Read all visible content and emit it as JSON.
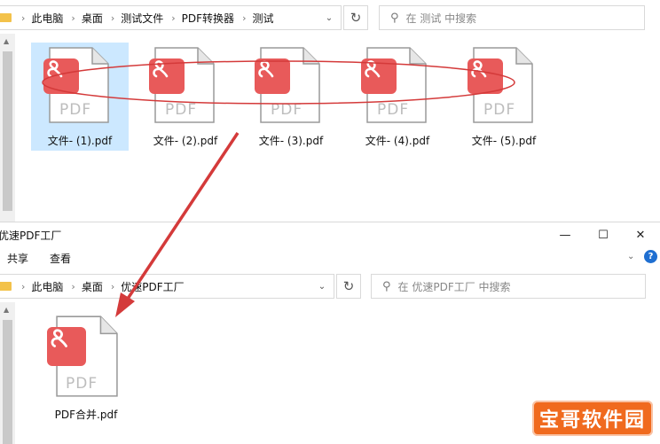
{
  "top_window": {
    "breadcrumb": [
      "此电脑",
      "桌面",
      "测试文件",
      "PDF转换器",
      "测试"
    ],
    "search_placeholder": "在 测试 中搜索",
    "files": [
      "文件- (1).pdf",
      "文件- (2).pdf",
      "文件- (3).pdf",
      "文件- (4).pdf",
      "文件- (5).pdf"
    ]
  },
  "bottom_window": {
    "title": "优速PDF工厂",
    "controls": {
      "minimize": "—",
      "maximize": "☐",
      "close": "✕"
    },
    "ribbon_tabs": [
      "共享",
      "查看"
    ],
    "help_label": "?",
    "breadcrumb": [
      "此电脑",
      "桌面",
      "优速PDF工厂"
    ],
    "search_placeholder": "在 优速PDF工厂 中搜索",
    "files": [
      "PDF合并.pdf"
    ]
  },
  "icons": {
    "file_doc_label": "PDF",
    "refresh": "↻",
    "dropdown": "⌄",
    "search": "⚲",
    "scroll_up": "▲"
  },
  "colors": {
    "badge": "#e85a5a",
    "annotation": "#d43a3a",
    "selection": "#cce8ff",
    "watermark": "#f06a1e"
  },
  "watermark": "宝哥软件园"
}
